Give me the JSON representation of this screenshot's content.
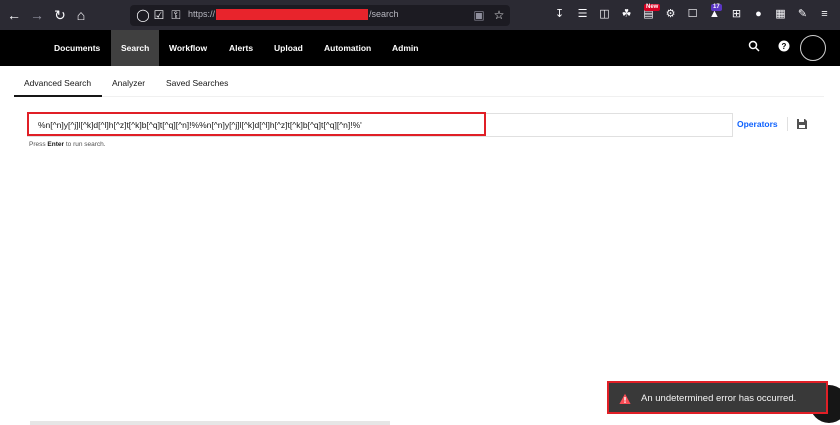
{
  "browser": {
    "url_prefix": "https://",
    "url_suffix": "/search",
    "badges": {
      "new": "New",
      "count": "17"
    }
  },
  "app_nav": {
    "items": [
      "Documents",
      "Search",
      "Workflow",
      "Alerts",
      "Upload",
      "Automation",
      "Admin"
    ],
    "active": "Search"
  },
  "tabs": {
    "items": [
      "Advanced Search",
      "Analyzer",
      "Saved Searches"
    ],
    "active": "Advanced Search"
  },
  "search": {
    "value": "%n[^n]y[^j]l[^k]d[^l]h[^z]t[^k]b[^q]t[^q][^n]!%%n[^n]y[^j]l[^k]d[^l]h[^z]t[^k]b[^q]t[^q][^n]!%'",
    "operators_label": "Operators",
    "hint_prefix": "Press ",
    "hint_key": "Enter",
    "hint_suffix": " to run search."
  },
  "toast": {
    "message": "An undetermined error has occurred.",
    "color": "#e01f26"
  },
  "colors": {
    "header_bg": "#000000",
    "active_nav_bg": "#404040",
    "link": "#0f62fe"
  }
}
